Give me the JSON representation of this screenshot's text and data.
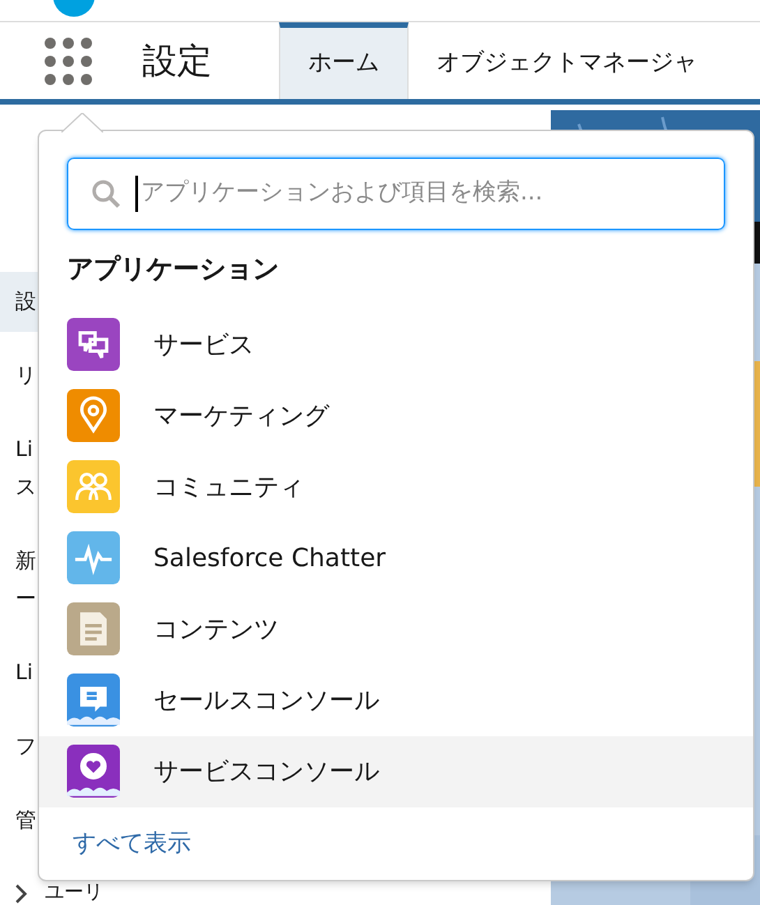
{
  "nav": {
    "title": "設定",
    "tabs": [
      {
        "label": "ホーム",
        "selected": true
      },
      {
        "label": "オブジェクトマネージャ",
        "selected": false
      }
    ]
  },
  "sidebar": {
    "items": [
      {
        "lines": [
          "設"
        ],
        "selected": true
      },
      {
        "lines": [
          "リ"
        ],
        "selected": false
      },
      {
        "lines": [
          "Li",
          "ス"
        ],
        "selected": false
      },
      {
        "lines": [
          "新",
          "ー"
        ],
        "selected": false
      },
      {
        "lines": [
          "Li"
        ],
        "selected": false
      },
      {
        "lines": [
          "フ"
        ],
        "selected": false
      },
      {
        "lines": [
          "管"
        ],
        "selected": false
      }
    ],
    "footer": {
      "label": "ユーリ",
      "expanded": false
    }
  },
  "launcher": {
    "search": {
      "placeholder": "アプリケーションおよび項目を検索..."
    },
    "heading": "アプリケーション",
    "apps": [
      {
        "label": "サービス",
        "kind": "service",
        "color": "#9a45c0",
        "selected": false
      },
      {
        "label": "マーケティング",
        "kind": "marketing",
        "color": "#ef8c00",
        "selected": false
      },
      {
        "label": "コミュニティ",
        "kind": "community",
        "color": "#fbc52e",
        "selected": false
      },
      {
        "label": "Salesforce Chatter",
        "kind": "chatter",
        "color": "#62b6ea",
        "selected": false
      },
      {
        "label": "コンテンツ",
        "kind": "content",
        "color": "#baa98a",
        "selected": false
      },
      {
        "label": "セールスコンソール",
        "kind": "sales_console",
        "color": "#3a91e2",
        "selected": false
      },
      {
        "label": "サービスコンソール",
        "kind": "service_console",
        "color": "#8a2fbd",
        "selected": true
      }
    ],
    "view_all": "すべて表示"
  }
}
